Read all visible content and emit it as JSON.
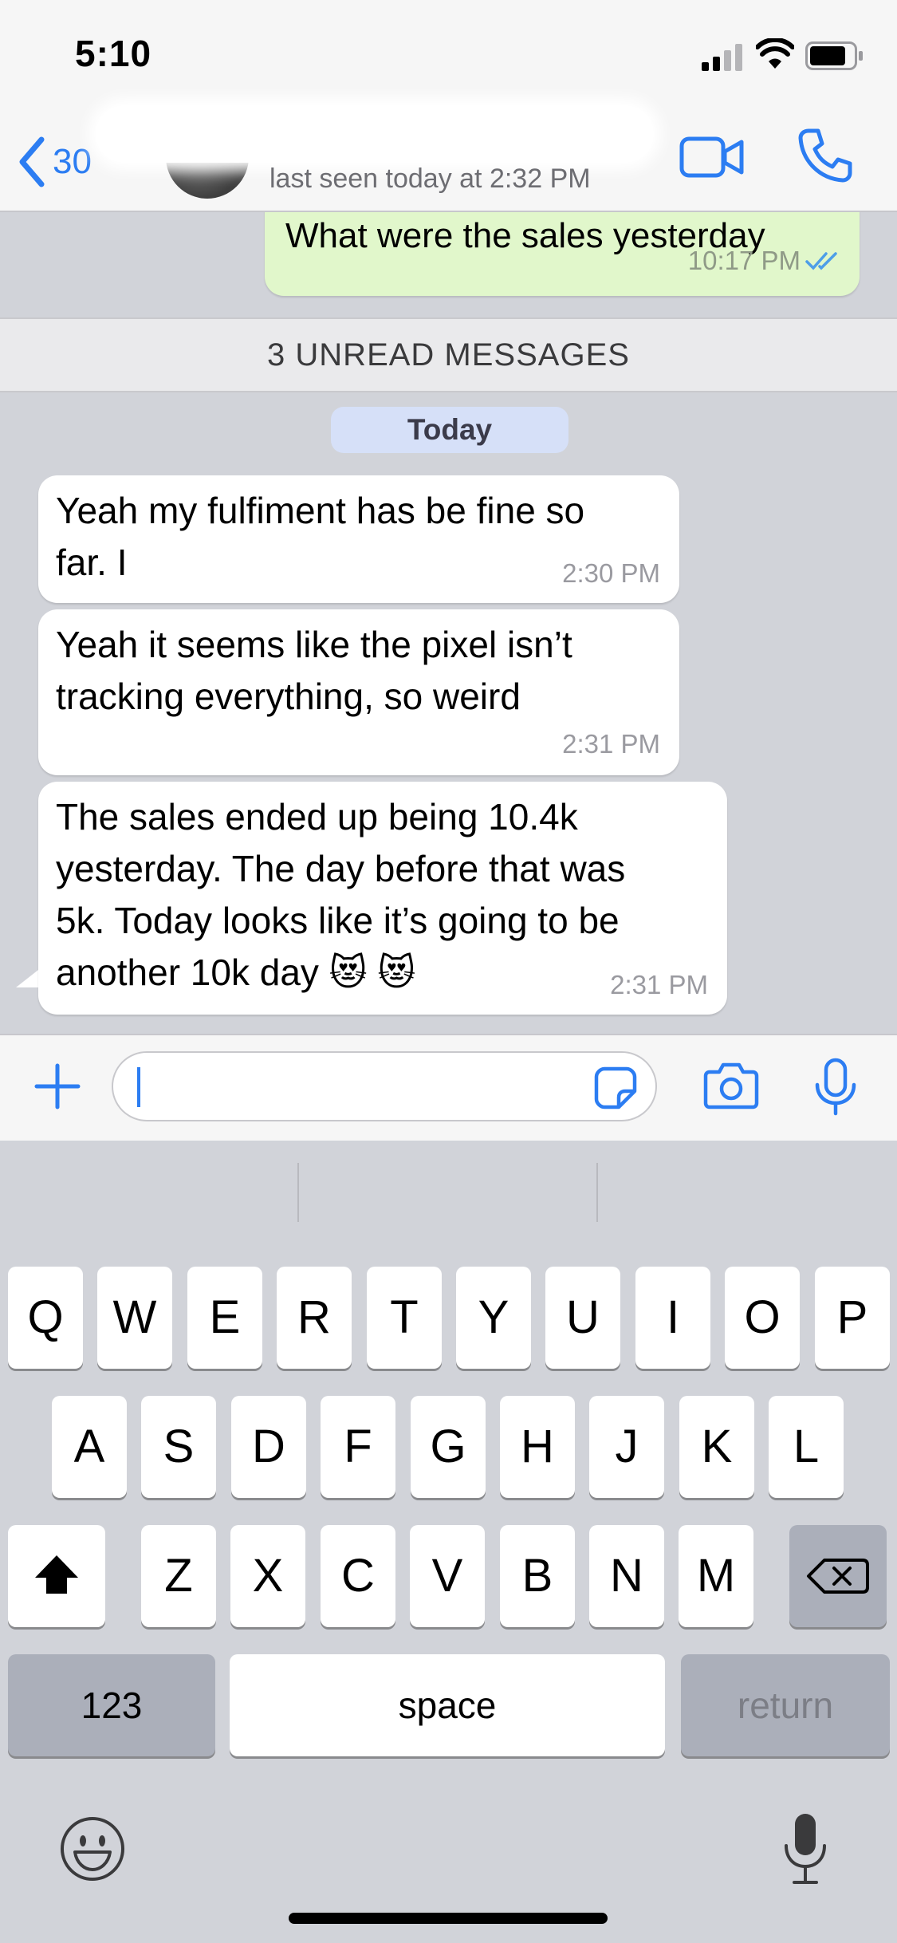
{
  "status_bar": {
    "time": "5:10"
  },
  "header": {
    "back_count": "30",
    "last_seen": "last seen today at 2:32 PM"
  },
  "chat": {
    "outgoing": {
      "text": "What were the sales yesterday",
      "time": "10:17 PM"
    },
    "unread_banner": "3 UNREAD MESSAGES",
    "date_label": "Today",
    "messages": [
      {
        "text": "Yeah my fulfiment has be fine so\nfar. I",
        "time": "2:30 PM"
      },
      {
        "text": "Yeah it seems like the pixel isn’t\ntracking everything, so weird",
        "time": "2:31 PM"
      },
      {
        "text": "The sales ended up being 10.4k\nyesterday. The day before that was\n5k. Today looks like it’s going to be\nanother 10k day 😻 😻",
        "time": "2:31 PM"
      }
    ]
  },
  "composer": {
    "placeholder": ""
  },
  "keyboard": {
    "row1": [
      "Q",
      "W",
      "E",
      "R",
      "T",
      "Y",
      "U",
      "I",
      "O",
      "P"
    ],
    "row2": [
      "A",
      "S",
      "D",
      "F",
      "G",
      "H",
      "J",
      "K",
      "L"
    ],
    "row3": [
      "Z",
      "X",
      "C",
      "V",
      "B",
      "N",
      "M"
    ],
    "num_label": "123",
    "space_label": "space",
    "return_label": "return"
  },
  "colors": {
    "accent": "#2c7df2",
    "outgoing_bubble": "#e1f7cb",
    "chat_background": "#d1d3d9"
  }
}
